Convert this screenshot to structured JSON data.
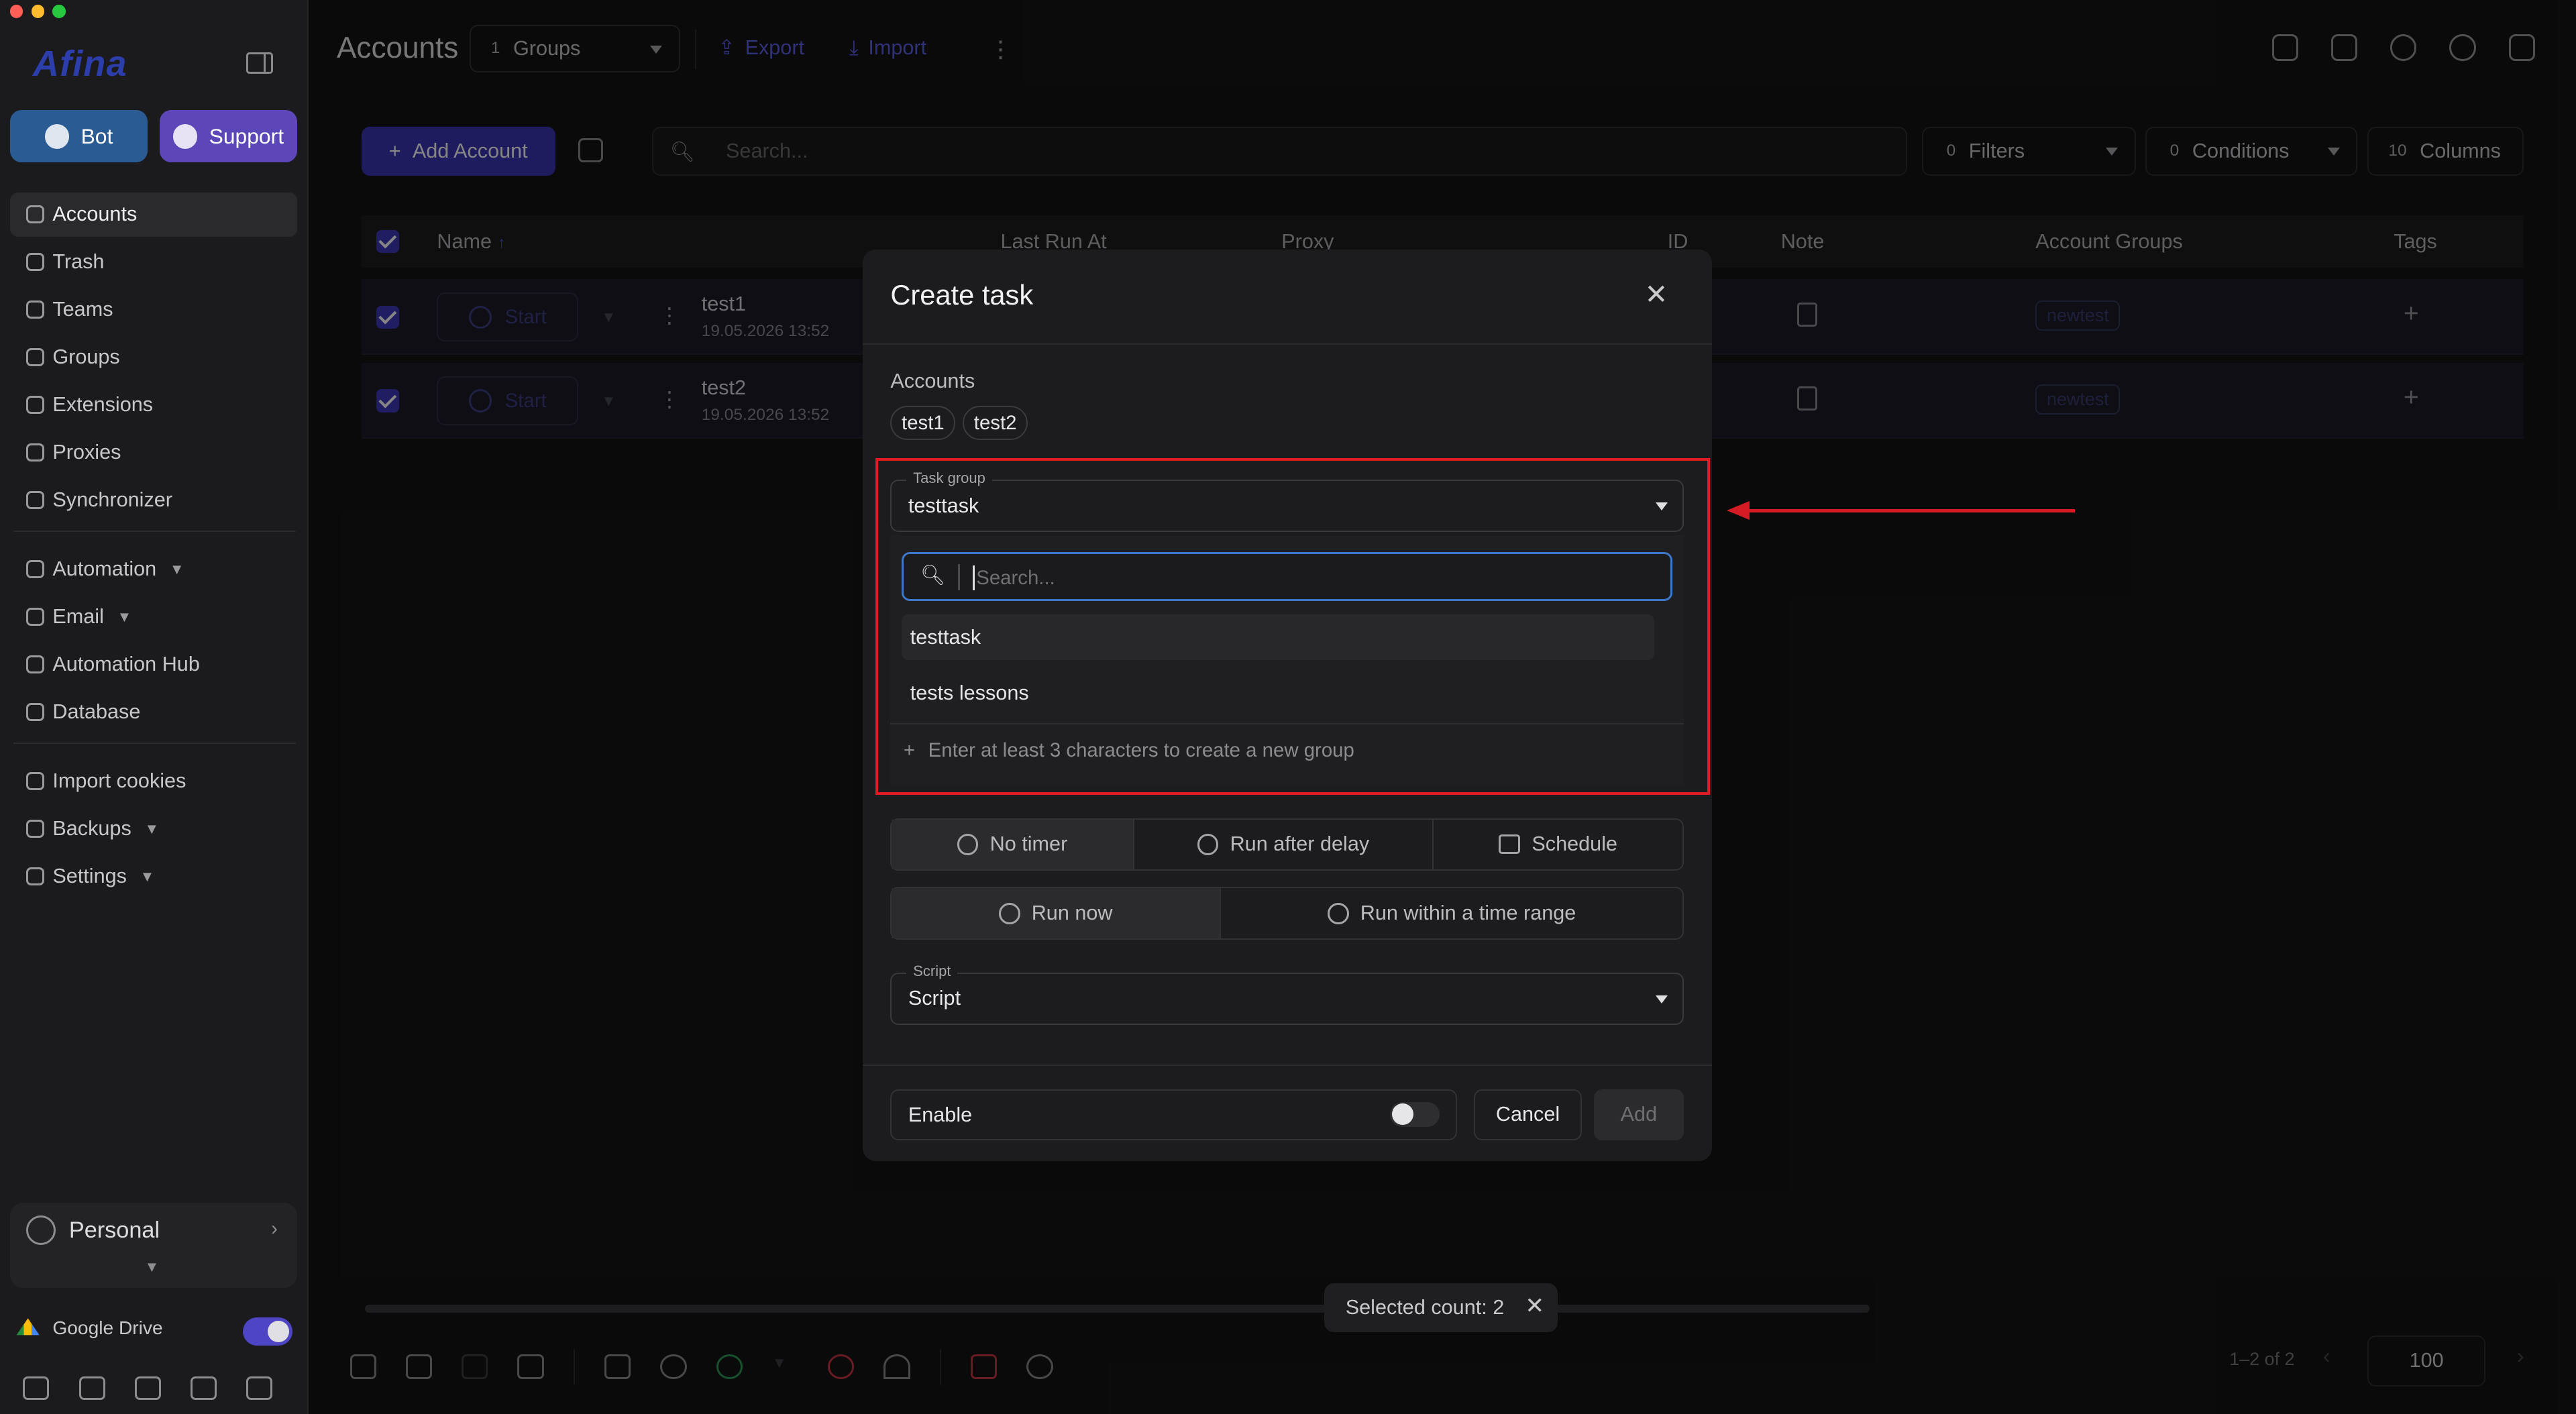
{
  "sidebar": {
    "logo": "Afina",
    "bot_label": "Bot",
    "support_label": "Support",
    "nav1": [
      "Accounts",
      "Trash",
      "Teams",
      "Groups",
      "Extensions",
      "Proxies",
      "Synchronizer"
    ],
    "nav2": [
      "Automation",
      "Email",
      "Automation Hub",
      "Database"
    ],
    "nav3": [
      "Import cookies",
      "Backups",
      "Settings"
    ],
    "profile": "Personal",
    "gdrive": "Google Drive"
  },
  "header": {
    "title": "Accounts",
    "groups_count": "1",
    "groups_label": "Groups",
    "export_label": "Export",
    "import_label": "Import"
  },
  "toolbar": {
    "add_account_label": "Add Account",
    "search_placeholder": "Search...",
    "filters_count": "0",
    "filters_label": "Filters",
    "conditions_count": "0",
    "conditions_label": "Conditions",
    "columns_count": "10",
    "columns_label": "Columns"
  },
  "table": {
    "columns": {
      "name": "Name",
      "sort_indicator": "↑",
      "last_run": "Last Run At",
      "proxy": "Proxy",
      "id": "ID",
      "note": "Note",
      "account_groups": "Account Groups",
      "tags": "Tags"
    },
    "start_label": "Start",
    "rows": [
      {
        "name": "test1",
        "date": "19.05.2026 13:52",
        "group": "newtest"
      },
      {
        "name": "test2",
        "date": "19.05.2026 13:52",
        "group": "newtest"
      }
    ]
  },
  "footer": {
    "selected_count": "Selected count: 2",
    "pagination": "1–2 of 2",
    "per_page": "100"
  },
  "modal": {
    "title": "Create task",
    "accounts_label": "Accounts",
    "accounts": [
      "test1",
      "test2"
    ],
    "task_group_label": "Task group",
    "task_group_value": "testtask",
    "search_placeholder": "Search...",
    "options": [
      "testtask",
      "tests lessons"
    ],
    "create_hint": "Enter at least 3 characters to create a new group",
    "timer_options": [
      "No timer",
      "Run after delay",
      "Schedule"
    ],
    "run_options": [
      "Run now",
      "Run within a time range"
    ],
    "script_label": "Script",
    "script_value": "Script",
    "enable_label": "Enable",
    "cancel_label": "Cancel",
    "add_label": "Add"
  },
  "colors": {
    "accent": "#3b35b4",
    "annotation": "#e01b24"
  }
}
